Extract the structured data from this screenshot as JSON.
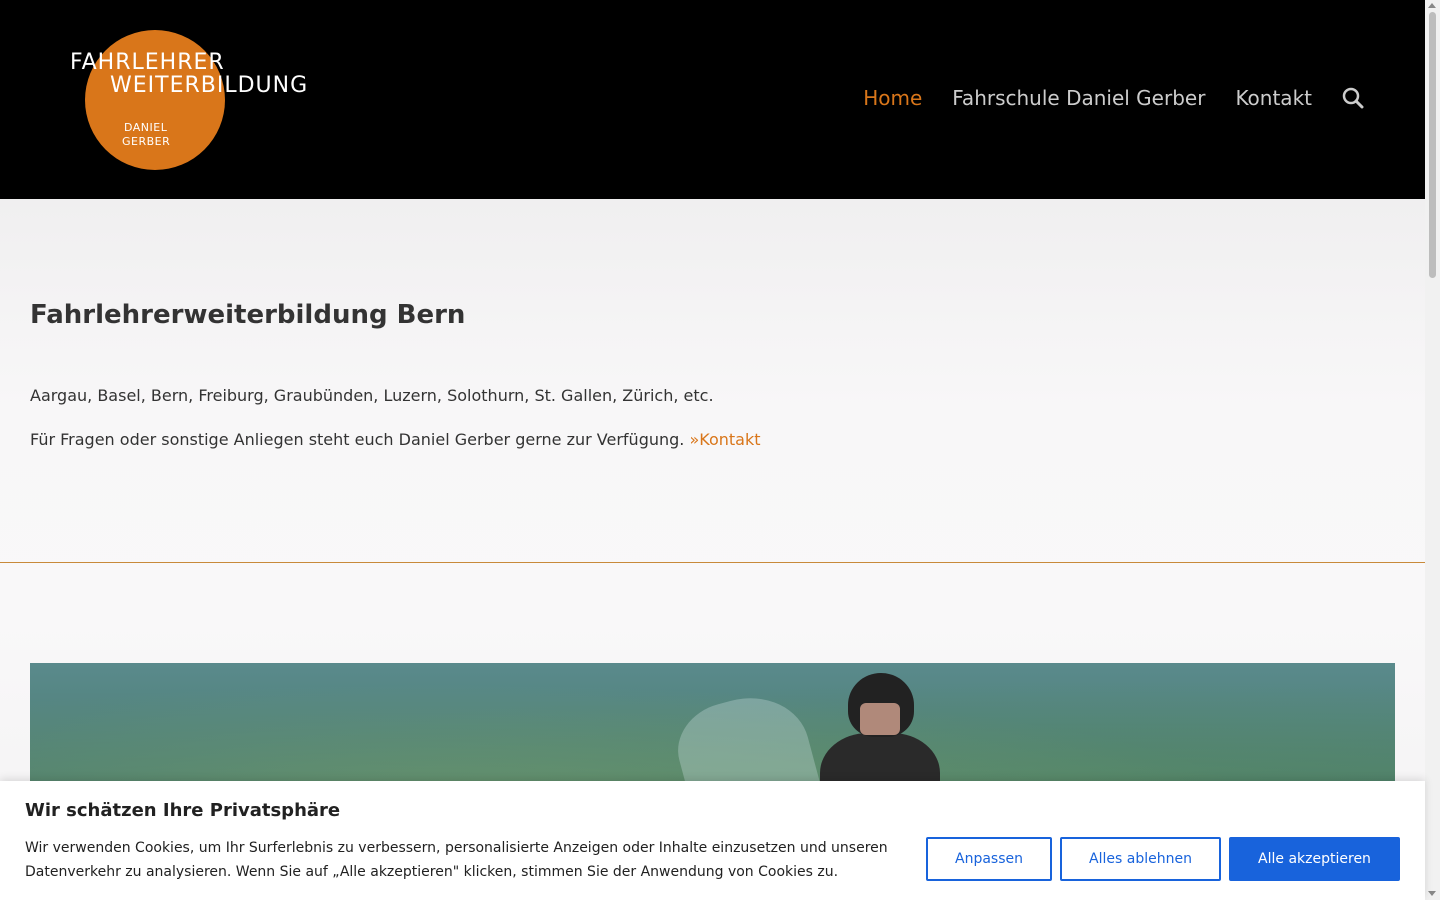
{
  "header": {
    "logo": {
      "line1": "FAHRLEHRER",
      "line2": "WEITERBILDUNG",
      "sub1": "DANIEL",
      "sub2": "GERBER"
    },
    "nav": [
      {
        "label": "Home",
        "active": true
      },
      {
        "label": "Fahrschule Daniel Gerber",
        "active": false
      },
      {
        "label": "Kontakt",
        "active": false
      }
    ],
    "search_icon": "search-icon"
  },
  "main": {
    "title": "Fahrlehrerweiterbildung Bern",
    "regions": "Aargau, Basel, Bern, Freiburg, Graubünden, Luzern, Solothurn, St. Gallen, Zürich, etc.",
    "contact_text": "Für Fragen oder sonstige Anliegen steht euch Daniel Gerber gerne zur Verfügung.",
    "contact_link": "»Kontakt"
  },
  "cookie": {
    "title": "Wir schätzen Ihre Privatsphäre",
    "text": "Wir verwenden Cookies, um Ihr Surferlebnis zu verbessern, personalisierte Anzeigen oder Inhalte einzusetzen und unseren Datenverkehr zu analysieren. Wenn Sie auf „Alle akzeptieren\" klicken, stimmen Sie der Anwendung von Cookies zu.",
    "customize_label": "Anpassen",
    "reject_label": "Alles ablehnen",
    "accept_label": "Alle akzeptieren"
  },
  "colors": {
    "accent": "#d9761a",
    "header_bg": "#000000",
    "button_blue": "#1863dc"
  }
}
